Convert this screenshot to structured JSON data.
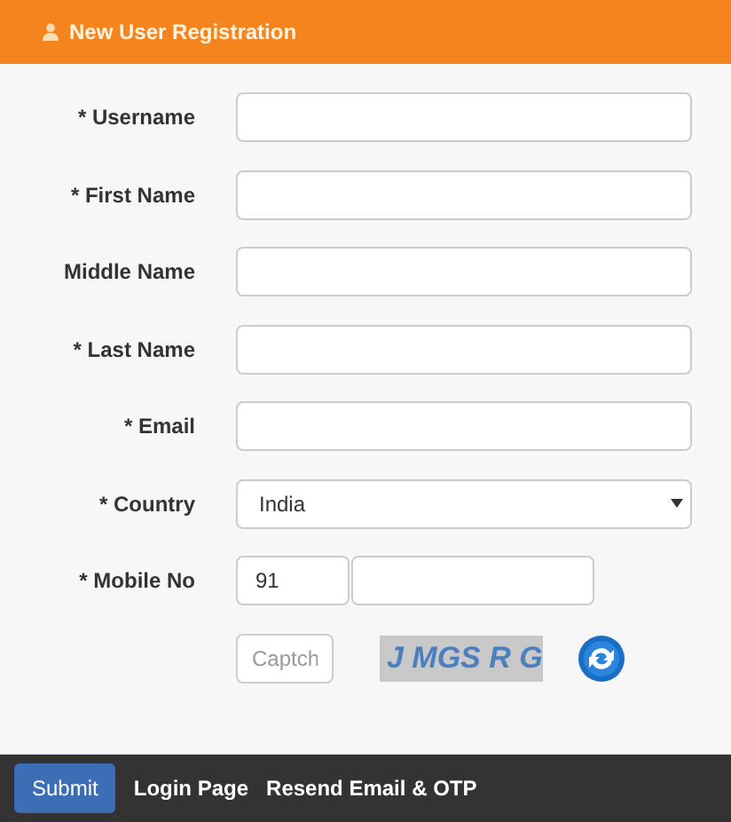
{
  "header": {
    "title": "New User Registration"
  },
  "fields": [
    {
      "kind": "text",
      "label": "* Username"
    },
    {
      "kind": "text",
      "label": "* First Name"
    },
    {
      "kind": "text",
      "label": "Middle Name"
    },
    {
      "kind": "text",
      "label": "* Last Name"
    },
    {
      "kind": "text",
      "label": "* Email"
    },
    {
      "kind": "select",
      "label": "* Country",
      "value": "India"
    },
    {
      "kind": "phone",
      "label": "* Mobile No",
      "code": "91"
    }
  ],
  "captcha": {
    "placeholder": "Captch",
    "image_text": "J MGS R G"
  },
  "footer": {
    "buttons": [
      "Submit"
    ],
    "links": [
      "Login Page",
      "Resend Email & OTP"
    ]
  }
}
